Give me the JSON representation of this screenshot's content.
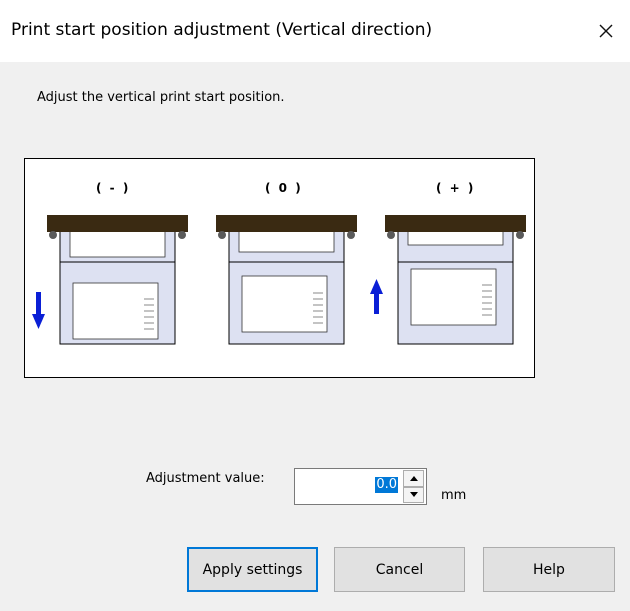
{
  "dialog": {
    "title": "Print start position adjustment (Vertical direction)",
    "instruction": "Adjust the vertical print start position.",
    "illustration": {
      "panels": [
        {
          "label": "( - )",
          "arrow": "down-arrow-icon"
        },
        {
          "label": "( 0 )",
          "arrow": ""
        },
        {
          "label": "( + )",
          "arrow": "up-arrow-icon"
        }
      ]
    },
    "adjustment": {
      "label": "Adjustment value:",
      "value": "0.0",
      "unit": "mm"
    },
    "buttons": {
      "apply": "Apply settings",
      "cancel": "Cancel",
      "help": "Help"
    }
  },
  "colors": {
    "arrow_blue": "#0a1fd6",
    "tray_dark": "#3a2a12",
    "tray_fill": "#dde1f2",
    "focus_blue": "#0078d7"
  }
}
